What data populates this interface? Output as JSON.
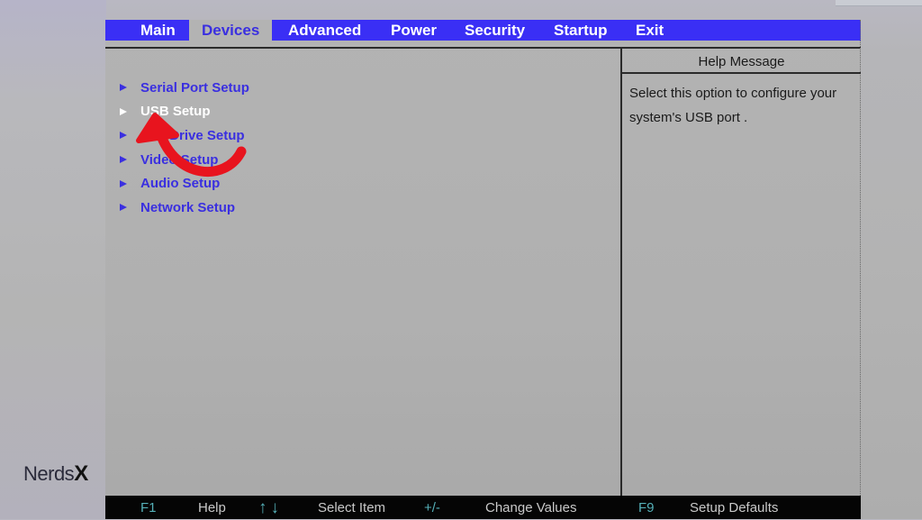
{
  "menubar": {
    "tabs": [
      {
        "label": "Main",
        "active": false
      },
      {
        "label": "Devices",
        "active": true
      },
      {
        "label": "Advanced",
        "active": false
      },
      {
        "label": "Power",
        "active": false
      },
      {
        "label": "Security",
        "active": false
      },
      {
        "label": "Startup",
        "active": false
      },
      {
        "label": "Exit",
        "active": false
      }
    ]
  },
  "devices_menu": {
    "items": [
      {
        "label": "Serial Port Setup",
        "selected": false
      },
      {
        "label": "USB Setup",
        "selected": true
      },
      {
        "label": "ATA Drive Setup",
        "selected": false
      },
      {
        "label": "Video Setup",
        "selected": false
      },
      {
        "label": "Audio Setup",
        "selected": false
      },
      {
        "label": "Network Setup",
        "selected": false
      }
    ]
  },
  "help": {
    "title": "Help Message",
    "line1": "Select this option to configure your",
    "line2": "system's USB port ."
  },
  "footer": {
    "f1_key": "F1",
    "f1_desc": "Help",
    "arrows_key": "↑↓",
    "arrows_desc": "Select Item",
    "plusminus_key": "+/-",
    "plusminus_desc": "Change Values",
    "f9_key": "F9",
    "f9_desc": "Setup Defaults"
  },
  "overlay": {
    "annotation": "red-curved-arrow pointing to USB Setup"
  },
  "watermark": {
    "text_regular": "Nerds",
    "text_bold": "X"
  },
  "colors": {
    "menubar_blue": "#3a2ff5",
    "item_blue": "#3a2fe0",
    "selected_white": "#ffffff",
    "footer_key_teal": "#55b0b8",
    "arrow_red": "#e8141e"
  }
}
